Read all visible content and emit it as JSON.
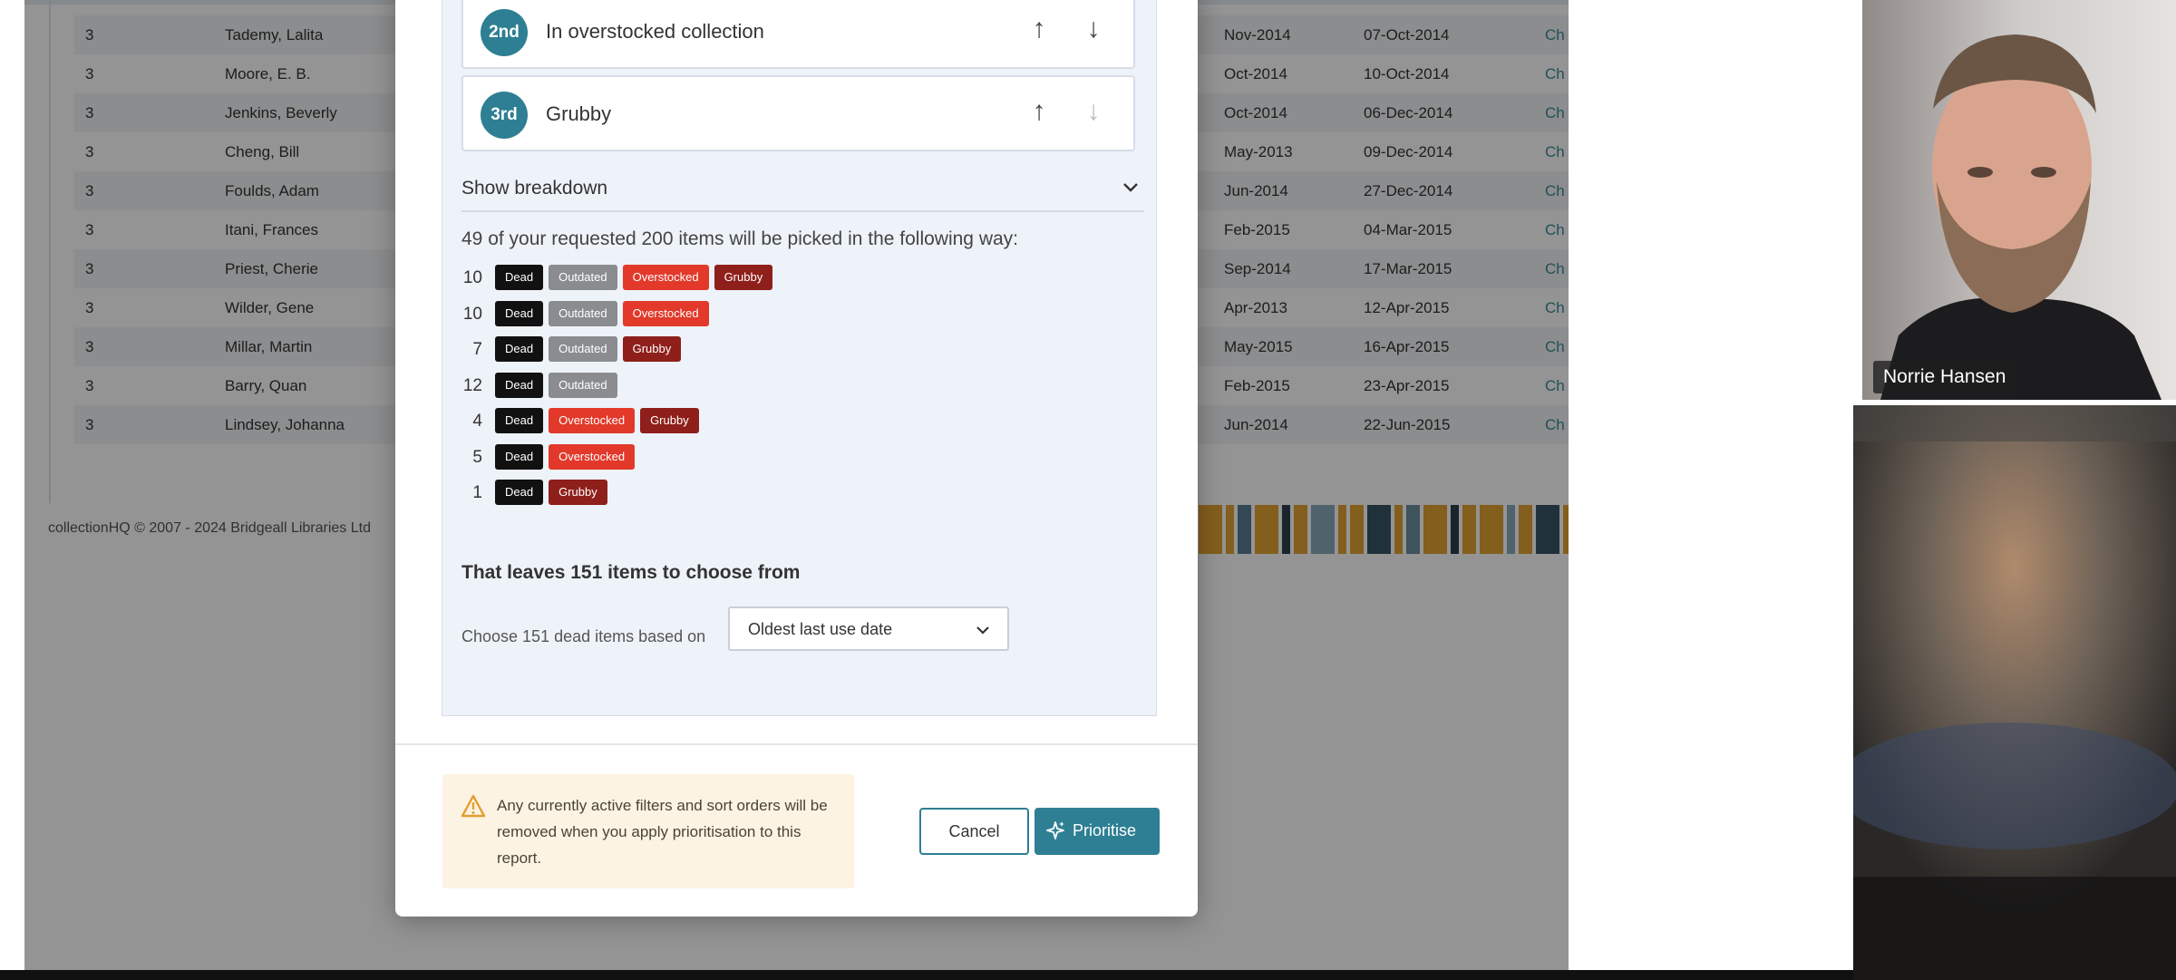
{
  "background_table": {
    "rows": [
      {
        "rank": "3",
        "name": "Tademy, Lalita",
        "date_1": "Nov-2014",
        "date_2": "07-Oct-2014",
        "action": "Ch"
      },
      {
        "rank": "3",
        "name": "Moore, E. B.",
        "date_1": "Oct-2014",
        "date_2": "10-Oct-2014",
        "action": "Ch"
      },
      {
        "rank": "3",
        "name": "Jenkins, Beverly",
        "date_1": "Oct-2014",
        "date_2": "06-Dec-2014",
        "action": "Ch"
      },
      {
        "rank": "3",
        "name": "Cheng, Bill",
        "date_1": "May-2013",
        "date_2": "09-Dec-2014",
        "action": "Ch"
      },
      {
        "rank": "3",
        "name": "Foulds, Adam",
        "date_1": "Jun-2014",
        "date_2": "27-Dec-2014",
        "action": "Ch"
      },
      {
        "rank": "3",
        "name": "Itani, Frances",
        "date_1": "Feb-2015",
        "date_2": "04-Mar-2015",
        "action": "Ch"
      },
      {
        "rank": "3",
        "name": "Priest, Cherie",
        "date_1": "Sep-2014",
        "date_2": "17-Mar-2015",
        "action": "Ch"
      },
      {
        "rank": "3",
        "name": "Wilder, Gene",
        "date_1": "Apr-2013",
        "date_2": "12-Apr-2015",
        "action": "Ch"
      },
      {
        "rank": "3",
        "name": "Millar, Martin",
        "date_1": "May-2015",
        "date_2": "16-Apr-2015",
        "action": "Ch"
      },
      {
        "rank": "3",
        "name": "Barry, Quan",
        "date_1": "Feb-2015",
        "date_2": "23-Apr-2015",
        "action": "Ch"
      },
      {
        "rank": "3",
        "name": "Lindsey, Johanna",
        "date_1": "Jun-2014",
        "date_2": "22-Jun-2015",
        "action": "Ch"
      }
    ],
    "footer": "collectionHQ © 2007 - 2024  Bridgeall Libraries Ltd"
  },
  "modal": {
    "priorities": [
      {
        "badge": "2nd",
        "label": "In overstocked collection",
        "down_enabled": true
      },
      {
        "badge": "3rd",
        "label": "Grubby",
        "down_enabled": false
      }
    ],
    "breakdown_label": "Show breakdown",
    "summary": "49 of your requested 200 items will be picked in the following way:",
    "tag_labels": {
      "dead": "Dead",
      "outdated": "Outdated",
      "overstocked": "Overstocked",
      "grubby": "Grubby"
    },
    "breakdown": [
      {
        "count": "10",
        "tags": [
          "dead",
          "outdated",
          "overstocked",
          "grubby"
        ]
      },
      {
        "count": "10",
        "tags": [
          "dead",
          "outdated",
          "overstocked"
        ]
      },
      {
        "count": "7",
        "tags": [
          "dead",
          "outdated",
          "grubby"
        ]
      },
      {
        "count": "12",
        "tags": [
          "dead",
          "outdated"
        ]
      },
      {
        "count": "4",
        "tags": [
          "dead",
          "overstocked",
          "grubby"
        ]
      },
      {
        "count": "5",
        "tags": [
          "dead",
          "overstocked"
        ]
      },
      {
        "count": "1",
        "tags": [
          "dead",
          "grubby"
        ]
      }
    ],
    "leaves_text": "That leaves 151 items to choose from",
    "choose_label": "Choose 151 dead items based on",
    "sort_select_value": "Oldest last use date",
    "warning_text": "Any currently active filters and sort orders will be removed when you apply prioritisation to this report.",
    "cancel_label": "Cancel",
    "prioritise_label": "Prioritise"
  },
  "video": {
    "participant_name": "Norrie Hansen"
  },
  "colors": {
    "accent": "#2e7f93",
    "dead": "#111111",
    "outdated": "#8a8c8f",
    "overstocked": "#e2392a",
    "grubby": "#8e1f1a",
    "warning_bg": "#fdf3e3"
  }
}
